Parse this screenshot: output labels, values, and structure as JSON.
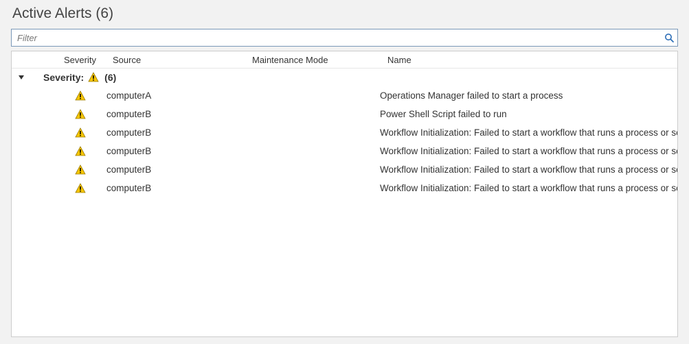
{
  "title_prefix": "Active Alerts",
  "title_count": "(6)",
  "filter_placeholder": "Filter",
  "columns": {
    "severity": "Severity",
    "source": "Source",
    "maintenance": "Maintenance Mode",
    "name": "Name"
  },
  "group": {
    "label": "Severity:",
    "severity_icon": "warning",
    "count": "(6)"
  },
  "rows": [
    {
      "severity_icon": "warning",
      "source": "computerA",
      "maintenance": "",
      "name": "Operations Manager failed to start a process"
    },
    {
      "severity_icon": "warning",
      "source": "computerB",
      "maintenance": "",
      "name": "Power Shell Script failed to run"
    },
    {
      "severity_icon": "warning",
      "source": "computerB",
      "maintenance": "",
      "name": "Workflow Initialization: Failed to start a workflow that runs a process or script"
    },
    {
      "severity_icon": "warning",
      "source": "computerB",
      "maintenance": "",
      "name": "Workflow Initialization: Failed to start a workflow that runs a process or script"
    },
    {
      "severity_icon": "warning",
      "source": "computerB",
      "maintenance": "",
      "name": "Workflow Initialization: Failed to start a workflow that runs a process or script"
    },
    {
      "severity_icon": "warning",
      "source": "computerB",
      "maintenance": "",
      "name": "Workflow Initialization: Failed to start a workflow that runs a process or script"
    }
  ]
}
